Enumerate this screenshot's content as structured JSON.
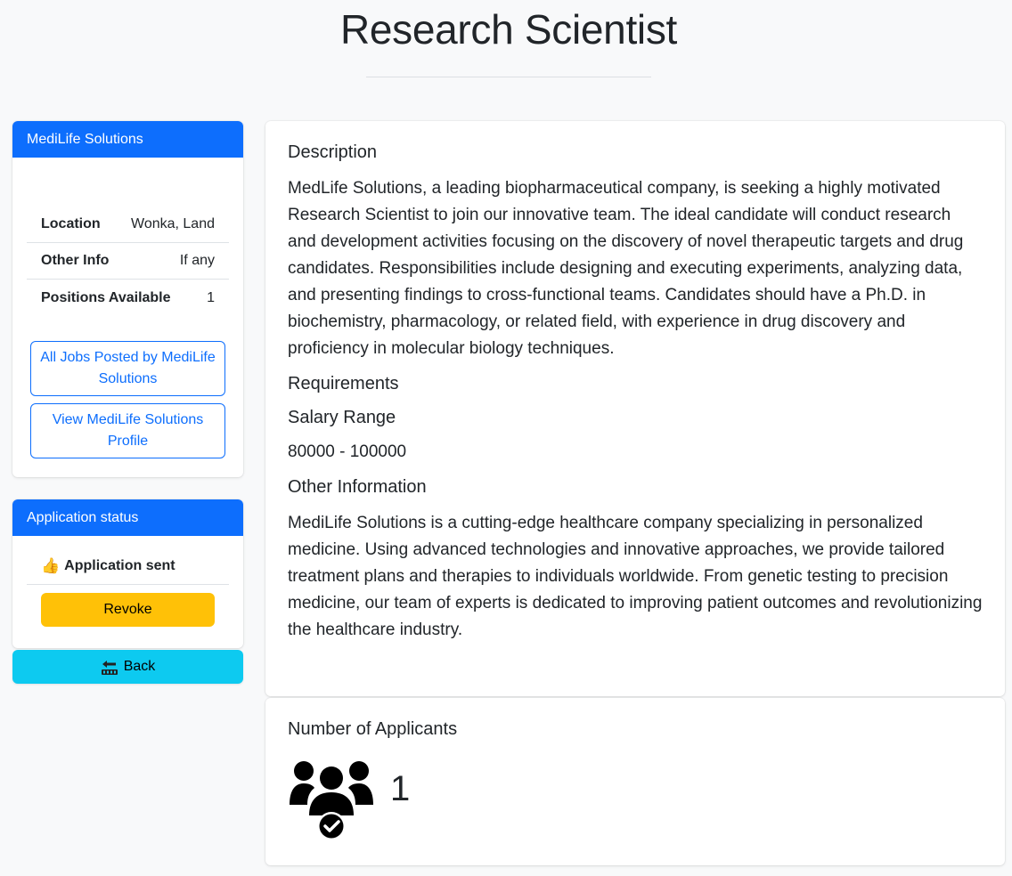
{
  "page": {
    "title": "Research Scientist"
  },
  "company_card": {
    "header": "MediLife Solutions",
    "info_rows": [
      {
        "key": "Location",
        "value": "Wonka, Land"
      },
      {
        "key": "Other Info",
        "value": "If any"
      },
      {
        "key": "Positions Available",
        "value": "1"
      }
    ],
    "all_jobs_button": "All Jobs Posted by MediLife Solutions",
    "view_profile_button": "View MediLife Solutions Profile"
  },
  "status_card": {
    "header": "Application status",
    "status_icon": "thumbs-up-icon",
    "status_text": "Application sent",
    "revoke_label": "Revoke"
  },
  "back_button": {
    "icon": "back-arrow-icon",
    "label": "Back"
  },
  "job": {
    "description_heading": "Description",
    "description": "MedLife Solutions, a leading biopharmaceutical company, is seeking a highly motivated Research Scientist to join our innovative team. The ideal candidate will conduct research and development activities focusing on the discovery of novel therapeutic targets and drug candidates. Responsibilities include designing and executing experiments, analyzing data, and presenting findings to cross-functional teams. Candidates should have a Ph.D. in biochemistry, pharmacology, or related field, with experience in drug discovery and proficiency in molecular biology techniques.",
    "requirements_heading": "Requirements",
    "salary_heading": "Salary Range",
    "salary": "80000 - 100000",
    "other_heading": "Other Information",
    "other_info": "MediLife Solutions is a cutting-edge healthcare company specializing in personalized medicine. Using advanced technologies and innovative approaches, we provide tailored treatment plans and therapies to individuals worldwide. From genetic testing to precision medicine, our team of experts is dedicated to improving patient outcomes and revolutionizing the healthcare industry."
  },
  "applicants": {
    "heading": "Number of Applicants",
    "icon": "users-check-icon",
    "count": "1"
  },
  "colors": {
    "primary": "#0d6efd",
    "warning": "#ffc107",
    "info": "#0dcaf0",
    "background": "#f8f9fa"
  }
}
